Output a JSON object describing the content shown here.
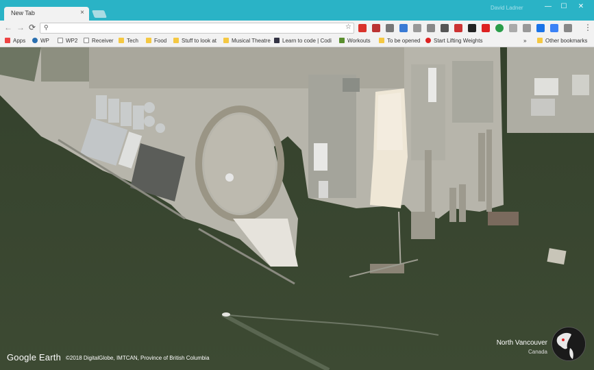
{
  "browser": {
    "tab_title": "New Tab",
    "tab_close": "×",
    "profile_name": "David Ladner",
    "minimize": "—",
    "maximize": "☐",
    "close": "✕",
    "back": "←",
    "forward": "→",
    "reload": "⟳",
    "omnibox_value": "",
    "search_icon": "⚲",
    "star_icon": "☆",
    "menu_icon": "⋮"
  },
  "bookmarks": {
    "items": [
      {
        "label": "Apps",
        "icon": "apps-icon"
      },
      {
        "label": "WP",
        "icon": "wordpress-icon"
      },
      {
        "label": "WP2",
        "icon": "page-icon"
      },
      {
        "label": "Receiver",
        "icon": "page-icon"
      },
      {
        "label": "Tech",
        "icon": "folder-icon"
      },
      {
        "label": "Food",
        "icon": "folder-icon"
      },
      {
        "label": "Stuff to look at",
        "icon": "folder-icon"
      },
      {
        "label": "Musical Theatre",
        "icon": "folder-icon"
      },
      {
        "label": "Learn to code | Codi",
        "icon": "code-icon"
      },
      {
        "label": "Workouts",
        "icon": "workout-icon"
      },
      {
        "label": "To be opened",
        "icon": "folder-icon"
      },
      {
        "label": "Start Lifting Weights",
        "icon": "weights-icon"
      }
    ],
    "overflow": "»",
    "other": "Other bookmarks"
  },
  "map": {
    "brand": "Google Earth",
    "credit": "©2018 DigitalGlobe, IMTCAN, Province of British Columbia",
    "location_name": "North Vancouver",
    "location_country": "Canada"
  },
  "colors": {
    "titlebar": "#2ab3c6",
    "water": "#39472f",
    "land": "#b7b5ab"
  }
}
